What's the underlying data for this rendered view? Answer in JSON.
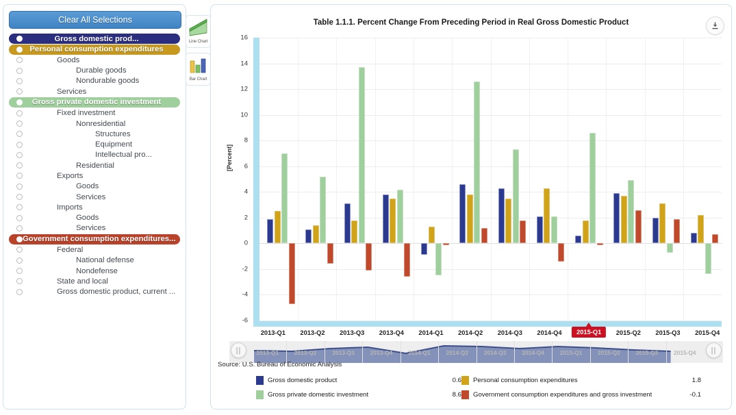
{
  "sidebar": {
    "clear_label": "Clear All Selections",
    "items": [
      {
        "label": "Gross domestic prod...",
        "indent": 0,
        "selected": true,
        "color": "blue"
      },
      {
        "label": "Personal consumption expenditures",
        "indent": 0,
        "selected": true,
        "color": "gold"
      },
      {
        "label": "Goods",
        "indent": 1,
        "selected": false
      },
      {
        "label": "Durable goods",
        "indent": 2,
        "selected": false
      },
      {
        "label": "Nondurable goods",
        "indent": 2,
        "selected": false
      },
      {
        "label": "Services",
        "indent": 1,
        "selected": false
      },
      {
        "label": "Gross private domestic investment",
        "indent": 0,
        "selected": true,
        "color": "green"
      },
      {
        "label": "Fixed investment",
        "indent": 1,
        "selected": false
      },
      {
        "label": "Nonresidential",
        "indent": 2,
        "selected": false
      },
      {
        "label": "Structures",
        "indent": 3,
        "selected": false
      },
      {
        "label": "Equipment",
        "indent": 3,
        "selected": false
      },
      {
        "label": "Intellectual pro...",
        "indent": 3,
        "selected": false
      },
      {
        "label": "Residential",
        "indent": 2,
        "selected": false
      },
      {
        "label": "Exports",
        "indent": 1,
        "selected": false
      },
      {
        "label": "Goods",
        "indent": 2,
        "selected": false
      },
      {
        "label": "Services",
        "indent": 2,
        "selected": false
      },
      {
        "label": "Imports",
        "indent": 1,
        "selected": false
      },
      {
        "label": "Goods",
        "indent": 2,
        "selected": false
      },
      {
        "label": "Services",
        "indent": 2,
        "selected": false
      },
      {
        "label": "Government consumption expenditures...",
        "indent": 0,
        "selected": true,
        "color": "red"
      },
      {
        "label": "Federal",
        "indent": 1,
        "selected": false
      },
      {
        "label": "National defense",
        "indent": 2,
        "selected": false
      },
      {
        "label": "Nondefense",
        "indent": 2,
        "selected": false
      },
      {
        "label": "State and local",
        "indent": 1,
        "selected": false
      },
      {
        "label": "Gross domestic product, current ...",
        "indent": 1,
        "selected": false
      }
    ]
  },
  "rail": {
    "buttons": [
      {
        "icon": "line-chart-icon",
        "label": "Line Chart"
      },
      {
        "icon": "bar-chart-icon",
        "label": "Bar Chart"
      }
    ]
  },
  "toolbar": {
    "download_icon": "download-icon"
  },
  "range_selector": {
    "left_handle": "||",
    "right_handle": "||",
    "ticks": [
      "2013-Q1",
      "2013-Q2",
      "2013-Q3",
      "2013-Q4",
      "2014-Q1",
      "2014-Q2",
      "2014-Q3",
      "2014-Q4",
      "2015-Q1",
      "2015-Q2",
      "2015-Q3",
      "2015-Q4"
    ]
  },
  "footer": {
    "source": "Source: U.S. Bureau of Economic Analysis"
  },
  "chart_data": {
    "type": "bar",
    "title": "Table 1.1.1. Percent Change From Preceding Period in Real Gross Domestic Product",
    "xlabel": "",
    "ylabel": "[Percent]",
    "ylim": [
      -6,
      16
    ],
    "yticks": [
      16,
      14,
      12,
      10,
      8,
      6,
      4,
      2,
      0,
      -2,
      -4,
      -6
    ],
    "grid": true,
    "legend_position": "bottom",
    "active_category": "2015-Q1",
    "categories": [
      "2013-Q1",
      "2013-Q2",
      "2013-Q3",
      "2013-Q4",
      "2014-Q1",
      "2014-Q2",
      "2014-Q3",
      "2014-Q4",
      "2015-Q1",
      "2015-Q2",
      "2015-Q3",
      "2015-Q4"
    ],
    "series": [
      {
        "name": "Gross domestic product",
        "color": "#2b3a8f",
        "highlight_value": "0.6",
        "values": [
          1.9,
          1.1,
          3.1,
          3.8,
          -0.9,
          4.6,
          4.3,
          2.1,
          0.6,
          3.9,
          2.0,
          0.8
        ]
      },
      {
        "name": "Personal consumption expenditures",
        "color": "#d1a318",
        "highlight_value": "1.8",
        "values": [
          2.5,
          1.4,
          1.8,
          3.5,
          1.3,
          3.8,
          3.5,
          4.3,
          1.8,
          3.7,
          3.1,
          2.2
        ]
      },
      {
        "name": "Gross private domestic investment",
        "color": "#9fcf9c",
        "highlight_value": "8.6",
        "values": [
          7.0,
          5.2,
          13.7,
          4.2,
          -2.5,
          12.6,
          7.3,
          2.1,
          8.6,
          4.9,
          -0.7,
          -2.4
        ]
      },
      {
        "name": "Government consumption expenditures and gross investment",
        "color": "#c0492c",
        "highlight_value": "-0.1",
        "values": [
          -4.7,
          -1.6,
          -2.1,
          -2.6,
          -0.1,
          1.2,
          1.8,
          -1.4,
          -0.1,
          2.6,
          1.9,
          0.7
        ]
      }
    ]
  }
}
